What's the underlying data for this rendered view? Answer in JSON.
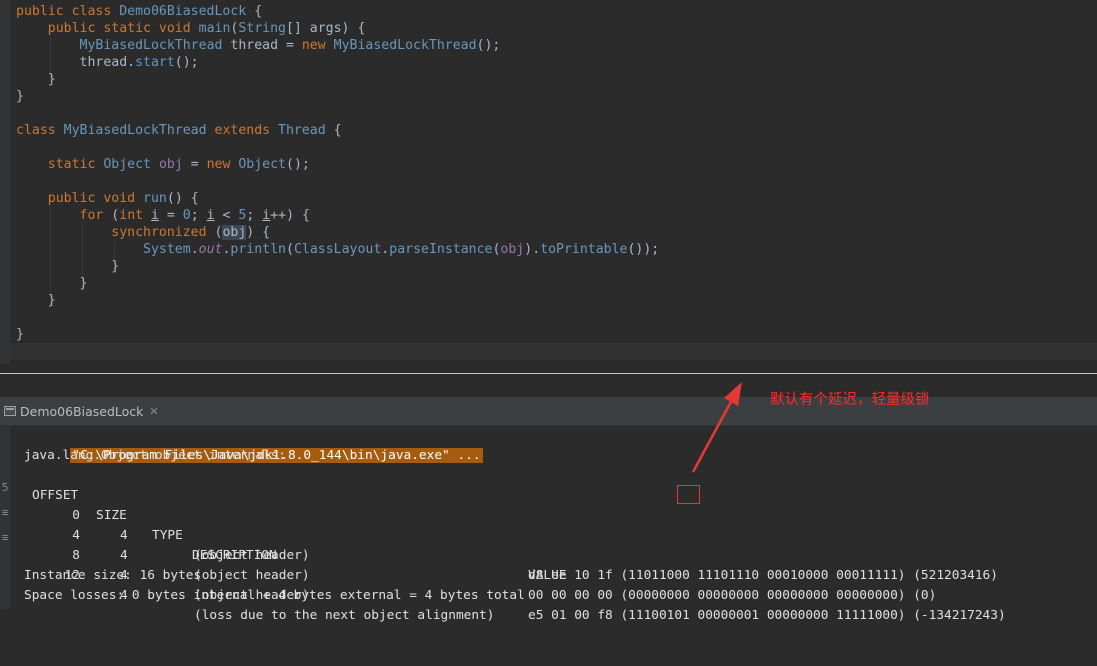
{
  "editor": {
    "lines": [
      "public class Demo06BiasedLock {",
      "    public static void main(String[] args) {",
      "        MyBiasedLockThread thread = new MyBiasedLockThread();",
      "        thread.start();",
      "    }",
      "}",
      "",
      "class MyBiasedLockThread extends Thread {",
      "",
      "    static Object obj = new Object();",
      "",
      "    public void run() {",
      "        for (int i = 0; i < 5; i++) {",
      "            synchronized (obj) {",
      "                System.out.println(ClassLayout.parseInstance(obj).toPrintable());",
      "            }",
      "        }",
      "    }",
      "",
      "}"
    ]
  },
  "run_panel": {
    "tab_label": "Demo06BiasedLock",
    "gutter_marks": [
      "5",
      "≡",
      "≡"
    ],
    "console": {
      "command": "\"C:\\Program Files\\Java\\jdk1.8.0_144\\bin\\java.exe\" ...",
      "internals_title": "java.lang.Object object internals:",
      "header": {
        "offset": "OFFSET",
        "size": "SIZE",
        "type": "TYPE",
        "description": "DESCRIPTION",
        "value": "VALUE"
      },
      "rows": [
        {
          "offset": "0",
          "size": "4",
          "description": "(object header)",
          "value": "d8 ee 10 1f (11011000 11101110 00010000 00011111) (521203416)"
        },
        {
          "offset": "4",
          "size": "4",
          "description": "(object header)",
          "value": "00 00 00 00 (00000000 00000000 00000000 00000000) (0)"
        },
        {
          "offset": "8",
          "size": "4",
          "description": "(object header)",
          "value": "e5 01 00 f8 (11100101 00000001 00000000 11111000) (-134217243)"
        },
        {
          "offset": "12",
          "size": "4",
          "description": "(loss due to the next object alignment)",
          "value": ""
        }
      ],
      "instance_size": "Instance size: 16 bytes",
      "space_losses": "Space losses: 0 bytes internal + 4 bytes external = 4 bytes total"
    }
  },
  "annotation": {
    "text": "默认有个延迟，轻量级锁",
    "color": "#ff2a2a"
  },
  "colors": {
    "editor_bg": "#2b2b2b",
    "keyword": "#cc7832",
    "class_name": "#6897bb",
    "command_bg": "#a65b0f"
  }
}
